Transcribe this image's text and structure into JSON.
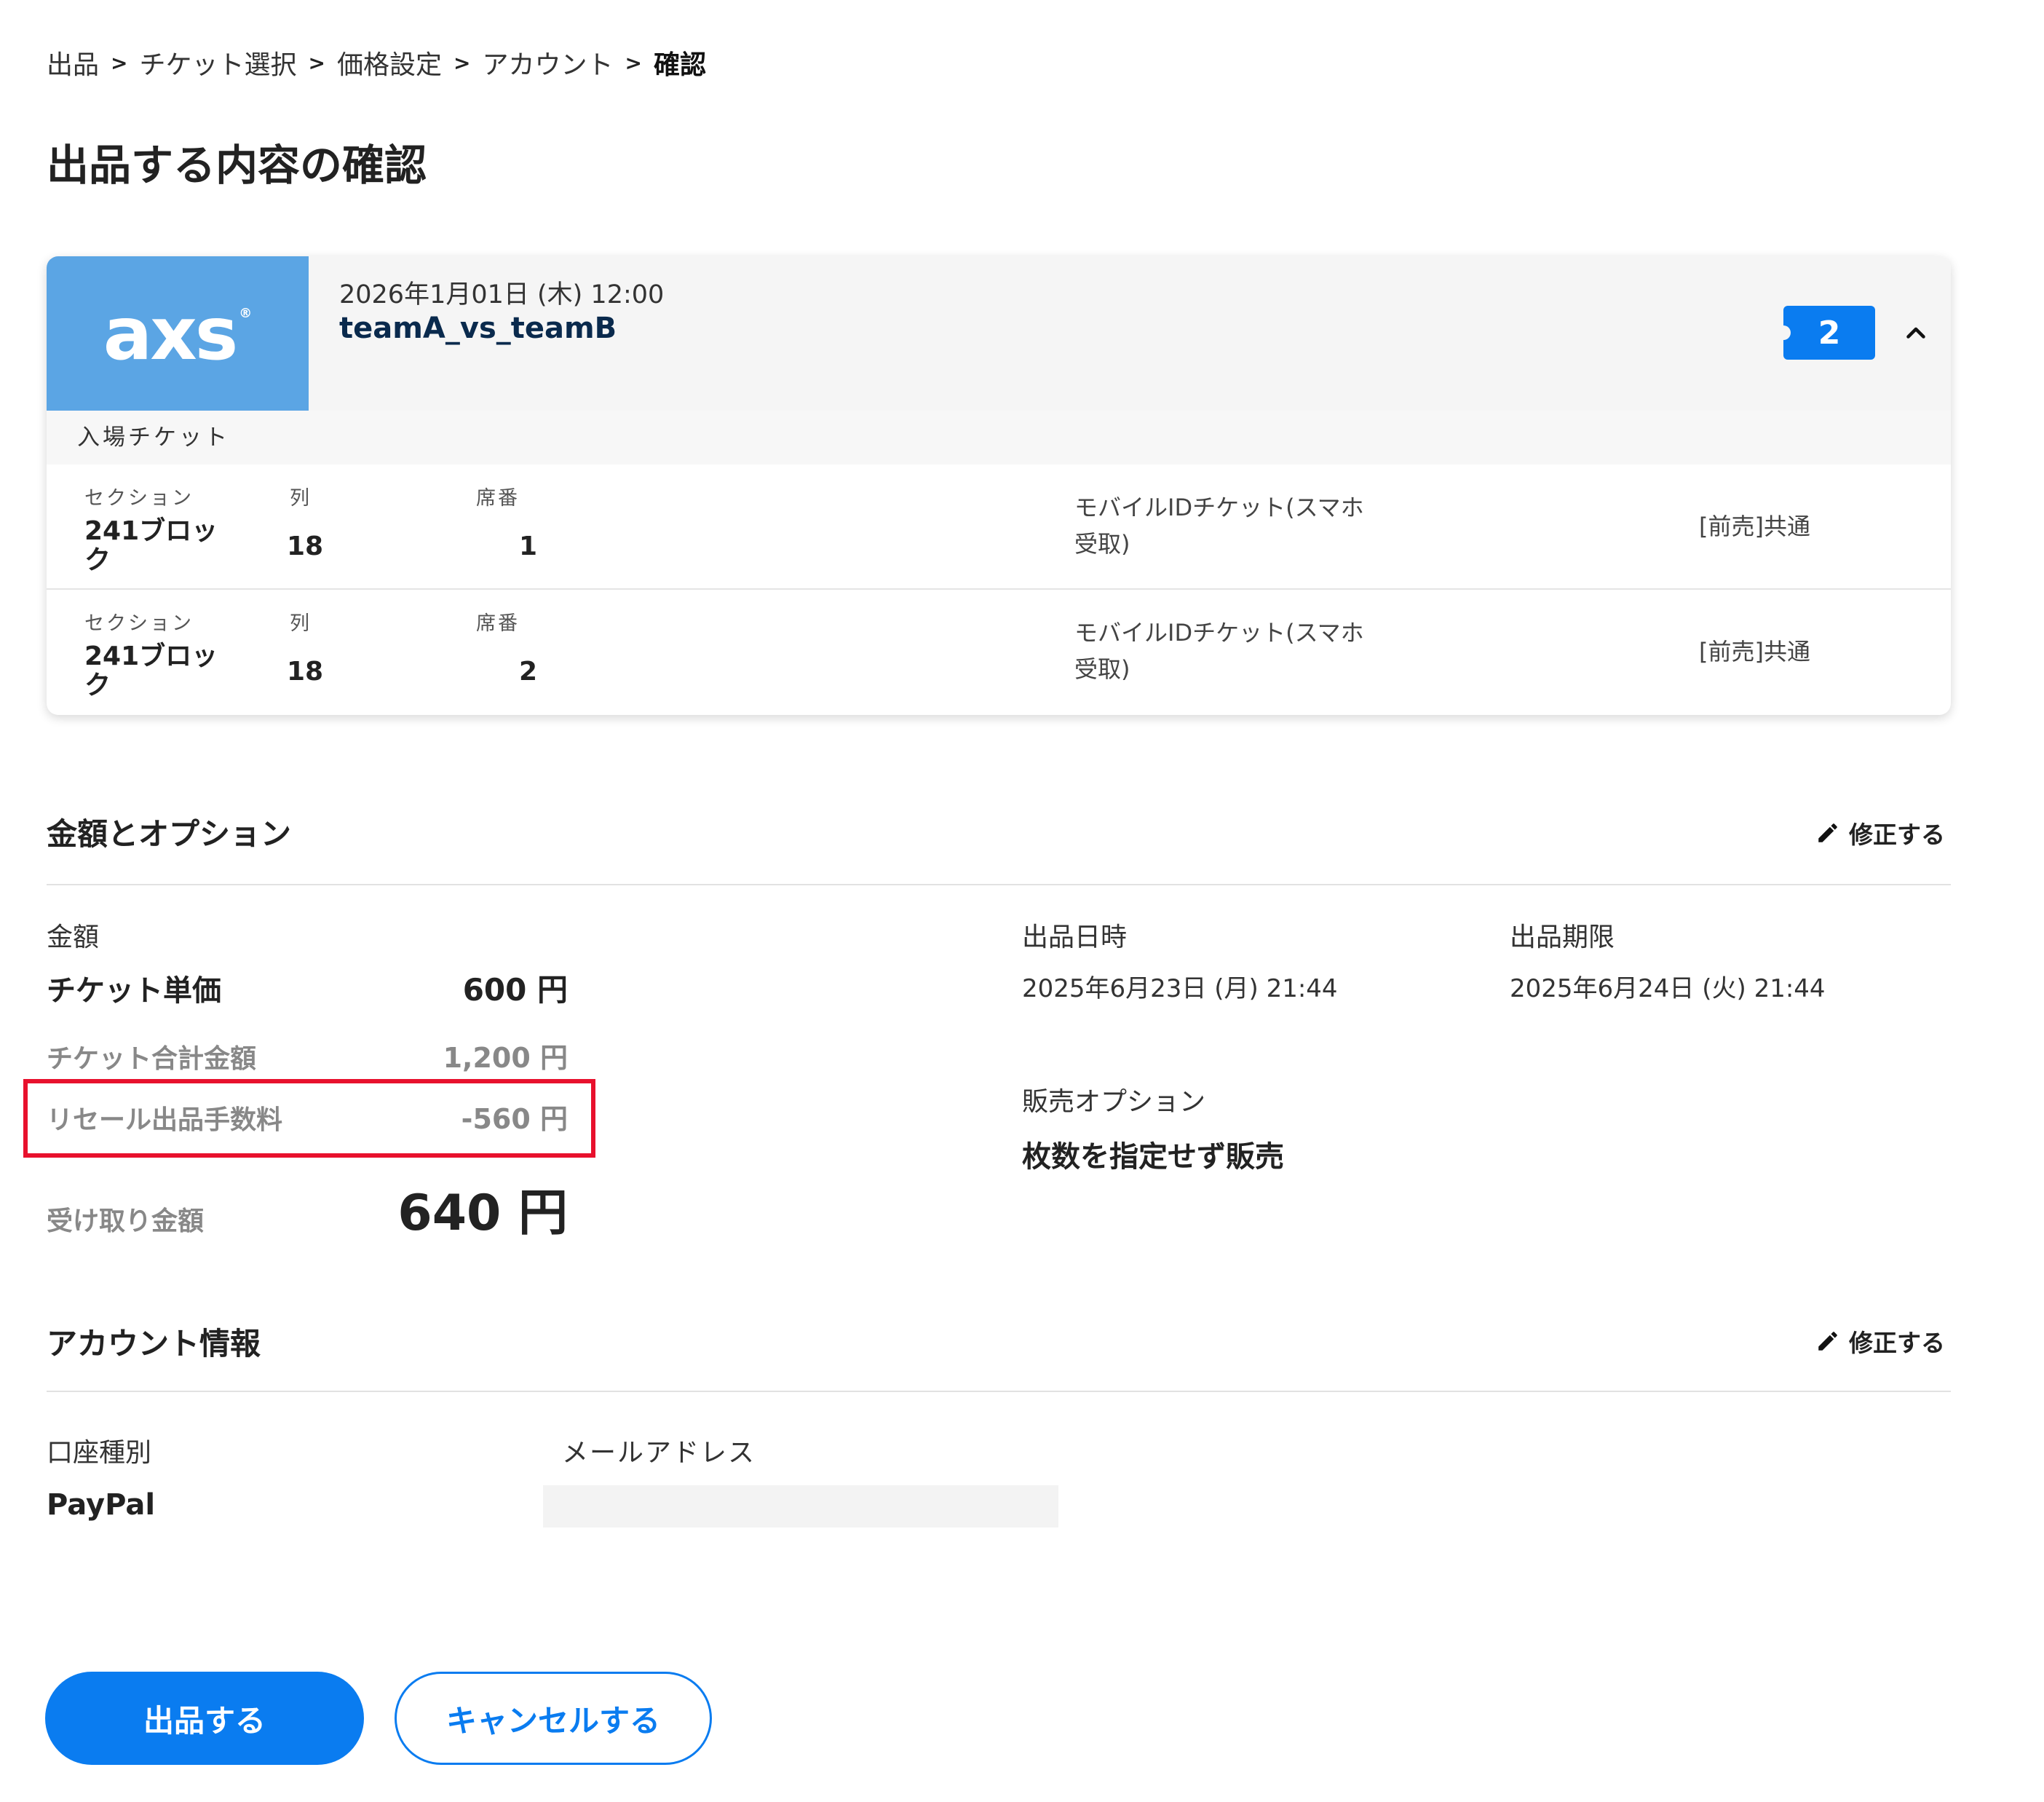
{
  "breadcrumb": {
    "items": [
      "出品",
      "チケット選択",
      "価格設定",
      "アカウント"
    ],
    "current": "確認",
    "separator": ">"
  },
  "page_title": "出品する内容の確認",
  "event": {
    "logo_text": "axs",
    "logo_mark": "®",
    "datetime": "2026年1月01日 (木) 12:00",
    "name": "teamA_vs_teamB",
    "ticket_count": "2",
    "ticket_category": "入場チケット",
    "expand_icon": "chevron-up-icon",
    "tickets": [
      {
        "section_label": "セクション",
        "section": "241ブロック",
        "row_label": "列",
        "row": "18",
        "seat_label": "席番",
        "seat": "1",
        "delivery": "モバイルIDチケット(スマホ受取)",
        "type": "[前売]共通"
      },
      {
        "section_label": "セクション",
        "section": "241ブロック",
        "row_label": "列",
        "row": "18",
        "seat_label": "席番",
        "seat": "2",
        "delivery": "モバイルIDチケット(スマホ受取)",
        "type": "[前売]共通"
      }
    ]
  },
  "pricing": {
    "section_title": "金額とオプション",
    "edit_label": "修正する",
    "amount_label": "金額",
    "unit_price_label": "チケット単価",
    "unit_price": "600 円",
    "total_label": "チケット合計金額",
    "total": "1,200 円",
    "fee_label": "リセール出品手数料",
    "fee": "-560 円",
    "receive_label": "受け取り金額",
    "receive": "640 円",
    "listing_date_label": "出品日時",
    "listing_date": "2025年6月23日 (月) 21:44",
    "deadline_label": "出品期限",
    "deadline": "2025年6月24日 (火) 21:44",
    "sale_option_label": "販売オプション",
    "sale_option": "枚数を指定せず販売"
  },
  "account": {
    "section_title": "アカウント情報",
    "edit_label": "修正する",
    "account_type_label": "口座種別",
    "account_type": "PayPal",
    "email_label": "メールアドレス",
    "email": ""
  },
  "actions": {
    "submit_label": "出品する",
    "cancel_label": "キャンセルする"
  },
  "colors": {
    "primary": "#0a7cf0",
    "logo_bg": "#5ba5e4",
    "highlight": "#e8112d"
  }
}
